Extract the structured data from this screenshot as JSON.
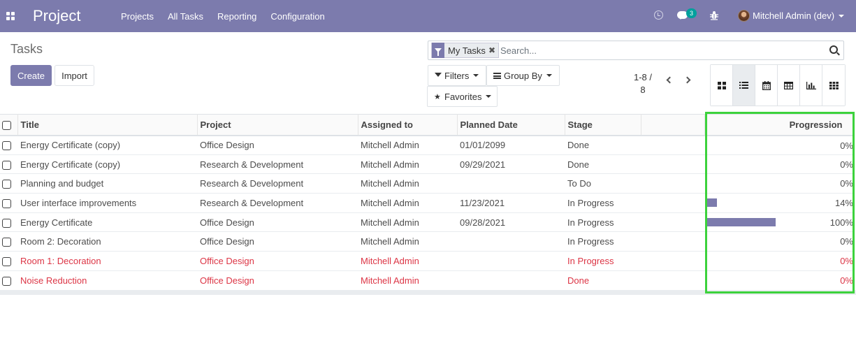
{
  "navbar": {
    "app_name": "Project",
    "menu": [
      "Projects",
      "All Tasks",
      "Reporting",
      "Configuration"
    ],
    "messages_badge": "3",
    "user": "Mitchell Admin (dev)"
  },
  "control_panel": {
    "title": "Tasks",
    "create_label": "Create",
    "import_label": "Import",
    "facet_label": "My Tasks",
    "search_placeholder": "Search...",
    "filters_label": "Filters",
    "groupby_label": "Group By",
    "favorites_label": "Favorites",
    "pager_value": "1-8 /",
    "pager_total": "8"
  },
  "table": {
    "columns": {
      "title": "Title",
      "project": "Project",
      "assigned": "Assigned to",
      "planned": "Planned Date",
      "stage": "Stage",
      "progression": "Progression"
    },
    "rows": [
      {
        "title": "Energy Certificate (copy)",
        "project": "Office Design",
        "assigned": "Mitchell Admin",
        "planned": "01/01/2099",
        "stage": "Done",
        "progress": 0,
        "progress_label": "0%",
        "overdue": false
      },
      {
        "title": "Energy Certificate (copy)",
        "project": "Research & Development",
        "assigned": "Mitchell Admin",
        "planned": "09/29/2021",
        "stage": "Done",
        "progress": 0,
        "progress_label": "0%",
        "overdue": false
      },
      {
        "title": "Planning and budget",
        "project": "Research & Development",
        "assigned": "Mitchell Admin",
        "planned": "",
        "stage": "To Do",
        "progress": 0,
        "progress_label": "0%",
        "overdue": false
      },
      {
        "title": "User interface improvements",
        "project": "Research & Development",
        "assigned": "Mitchell Admin",
        "planned": "11/23/2021",
        "stage": "In Progress",
        "progress": 14,
        "progress_label": "14%",
        "overdue": false
      },
      {
        "title": "Energy Certificate",
        "project": "Office Design",
        "assigned": "Mitchell Admin",
        "planned": "09/28/2021",
        "stage": "In Progress",
        "progress": 100,
        "progress_label": "100%",
        "overdue": false
      },
      {
        "title": "Room 2: Decoration",
        "project": "Office Design",
        "assigned": "Mitchell Admin",
        "planned": "",
        "stage": "In Progress",
        "progress": 0,
        "progress_label": "0%",
        "overdue": false
      },
      {
        "title": "Room 1: Decoration",
        "project": "Office Design",
        "assigned": "Mitchell Admin",
        "planned": "",
        "stage": "In Progress",
        "progress": 0,
        "progress_label": "0%",
        "overdue": true
      },
      {
        "title": "Noise Reduction",
        "project": "Office Design",
        "assigned": "Mitchell Admin",
        "planned": "",
        "stage": "Done",
        "progress": 0,
        "progress_label": "0%",
        "overdue": true
      }
    ]
  },
  "colors": {
    "brand": "#7c7bad",
    "danger": "#dc3545",
    "badge": "#00a09d",
    "highlight": "#3cd23c"
  }
}
